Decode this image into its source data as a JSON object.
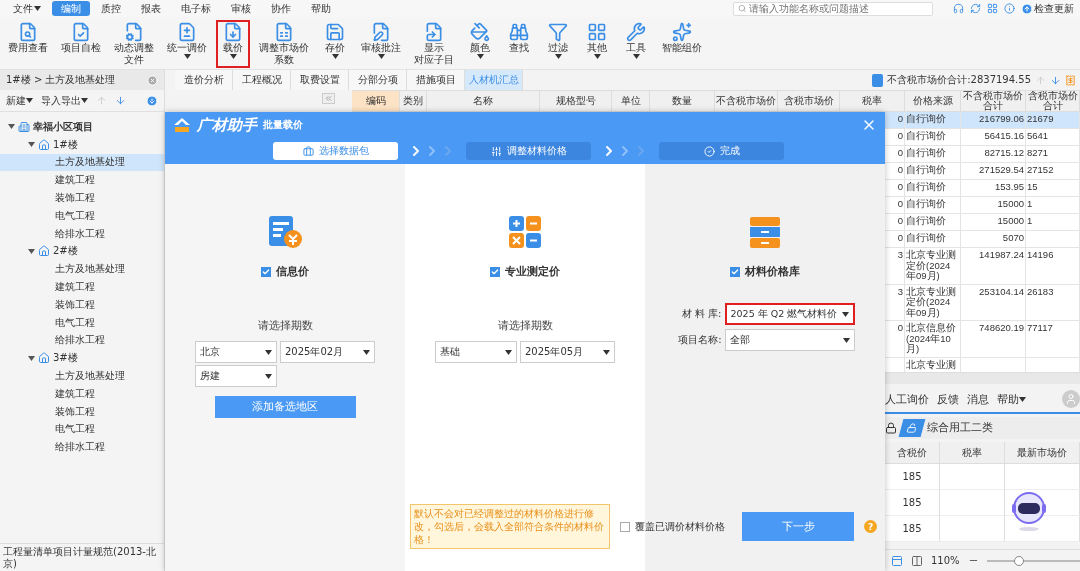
{
  "menu": {
    "items": [
      {
        "label": "文件",
        "dropdown": true,
        "selected": false
      },
      {
        "label": "编制",
        "dropdown": false,
        "selected": true
      },
      {
        "label": "质控",
        "dropdown": false,
        "selected": false
      },
      {
        "label": "报表",
        "dropdown": false,
        "selected": false
      },
      {
        "label": "电子标",
        "dropdown": false,
        "selected": false
      },
      {
        "label": "审核",
        "dropdown": false,
        "selected": false
      },
      {
        "label": "协作",
        "dropdown": false,
        "selected": false
      },
      {
        "label": "帮助",
        "dropdown": false,
        "selected": false
      }
    ],
    "search": {
      "placeholder": "请输入功能名称或问题描述"
    },
    "update": "检查更新"
  },
  "ribbon": [
    {
      "label": "费用查看",
      "dropdown": false,
      "highlighted": false
    },
    {
      "label": "项目自检",
      "dropdown": false,
      "highlighted": false
    },
    {
      "lines": [
        "动态调整",
        "文件"
      ],
      "dropdown": false,
      "highlighted": false
    },
    {
      "label": "统一调价",
      "dropdown": true,
      "highlighted": false
    },
    {
      "label": "载价",
      "dropdown": true,
      "highlighted": true
    },
    {
      "lines": [
        "调整市场价",
        "系数"
      ],
      "dropdown": false,
      "highlighted": false
    },
    {
      "label": "存价",
      "dropdown": true,
      "highlighted": false
    },
    {
      "label": "审核批注",
      "dropdown": true,
      "highlighted": false
    },
    {
      "lines": [
        "显示",
        "对应子目"
      ],
      "dropdown": false,
      "highlighted": false
    },
    {
      "label": "颜色",
      "dropdown": true,
      "highlighted": false
    },
    {
      "label": "查找",
      "dropdown": false,
      "highlighted": false
    },
    {
      "label": "过滤",
      "dropdown": true,
      "highlighted": false
    },
    {
      "label": "其他",
      "dropdown": true,
      "highlighted": false
    },
    {
      "label": "工具",
      "dropdown": true,
      "highlighted": false
    },
    {
      "label": "智能组价",
      "dropdown": false,
      "highlighted": false
    }
  ],
  "sidebar": {
    "breadcrumb": "1#楼 > 土方及地基处理",
    "toolbar": [
      {
        "label": "新建",
        "dropdown": true
      },
      {
        "label": "导入导出",
        "dropdown": true
      }
    ],
    "arrows": [
      {
        "kind": "up",
        "disabled": true
      },
      {
        "kind": "down",
        "disabled": false
      }
    ],
    "tree": [
      {
        "label": "幸福小区项目",
        "expanded": true,
        "selected": false,
        "children": [
          {
            "label": "1#楼",
            "expanded": true,
            "selected": false,
            "children": [
              {
                "label": "土方及地基处理",
                "selected": true
              },
              {
                "label": "建筑工程",
                "selected": false
              },
              {
                "label": "装饰工程",
                "selected": false
              },
              {
                "label": "电气工程",
                "selected": false
              },
              {
                "label": "给排水工程",
                "selected": false
              }
            ]
          },
          {
            "label": "2#楼",
            "expanded": true,
            "selected": false,
            "children": [
              {
                "label": "土方及地基处理",
                "selected": false
              },
              {
                "label": "建筑工程",
                "selected": false
              },
              {
                "label": "装饰工程",
                "selected": false
              },
              {
                "label": "电气工程",
                "selected": false
              },
              {
                "label": "给排水工程",
                "selected": false
              }
            ]
          },
          {
            "label": "3#楼",
            "expanded": true,
            "selected": false,
            "children": [
              {
                "label": "土方及地基处理",
                "selected": false
              },
              {
                "label": "建筑工程",
                "selected": false
              },
              {
                "label": "装饰工程",
                "selected": false
              },
              {
                "label": "电气工程",
                "selected": false
              },
              {
                "label": "给排水工程",
                "selected": false
              }
            ]
          }
        ]
      }
    ],
    "status": "工程量清单项目计量规范(2013-北京)"
  },
  "tabs": [
    {
      "label": "造价分析",
      "selected": false
    },
    {
      "label": "工程概况",
      "selected": false
    },
    {
      "label": "取费设置",
      "selected": false
    },
    {
      "label": "分部分项",
      "selected": false
    },
    {
      "label": "措施项目",
      "selected": false
    },
    {
      "label": "人材机汇总",
      "selected": true
    }
  ],
  "total": "不含税市场价合计:2837194.55",
  "table": {
    "columns": [
      {
        "label": "编码",
        "selected": true
      },
      {
        "label": "类别",
        "selected": false
      },
      {
        "label": "名称",
        "selected": false
      },
      {
        "label": "规格型号",
        "selected": false
      },
      {
        "label": "单位",
        "selected": false
      },
      {
        "label": "数量",
        "selected": false
      },
      {
        "label": "不含税市场价",
        "selected": false
      },
      {
        "label": "含税市场价",
        "selected": false
      },
      {
        "label": "税率",
        "selected": false
      },
      {
        "label": "价格来源",
        "selected": false
      },
      {
        "label": "不含税市场价合计",
        "selected": false
      },
      {
        "label": "含税市场价合计",
        "selected": false
      }
    ],
    "rows": [
      {
        "tax_rate": "0",
        "price_source": "自行询价",
        "total_excl_tax": "216799.06",
        "total_incl_tax": "21679",
        "selected": true
      },
      {
        "tax_rate": "0",
        "price_source": "自行询价",
        "total_excl_tax": "56415.16",
        "total_incl_tax": "5641",
        "selected": false
      },
      {
        "tax_rate": "0",
        "price_source": "自行询价",
        "total_excl_tax": "82715.12",
        "total_incl_tax": "8271",
        "selected": false
      },
      {
        "tax_rate": "0",
        "price_source": "自行询价",
        "total_excl_tax": "271529.54",
        "total_incl_tax": "27152",
        "selected": false
      },
      {
        "tax_rate": "0",
        "price_source": "自行询价",
        "total_excl_tax": "153.95",
        "total_incl_tax": "15",
        "selected": false
      },
      {
        "tax_rate": "0",
        "price_source": "自行询价",
        "total_excl_tax": "15000",
        "total_incl_tax": "1",
        "selected": false
      },
      {
        "tax_rate": "0",
        "price_source": "自行询价",
        "total_excl_tax": "15000",
        "total_incl_tax": "1",
        "selected": false
      },
      {
        "tax_rate": "0",
        "price_source": "自行询价",
        "total_excl_tax": "5070",
        "selected": false
      },
      {
        "tax_rate": "3",
        "price_source": "北京专业测定价(2024年09月)",
        "total_excl_tax": "141987.24",
        "total_incl_tax": "14196",
        "selected": false
      },
      {
        "tax_rate": "3",
        "price_source": "北京专业测定价(2024年09月)",
        "total_excl_tax": "253104.14",
        "total_incl_tax": "26183",
        "selected": false
      },
      {
        "tax_rate": "0",
        "price_source": "北京信息价(2024年10月)",
        "total_excl_tax": "748620.19",
        "total_incl_tax": "77117",
        "selected": false
      },
      {
        "price_source": "北京专业测",
        "selected": false
      }
    ]
  },
  "lower_panel": {
    "toolbar": [
      {
        "label": "人工询价",
        "dropdown": false
      },
      {
        "label": "反馈",
        "dropdown": false
      },
      {
        "label": "消息",
        "dropdown": false
      },
      {
        "label": "帮助",
        "dropdown": true
      }
    ],
    "tab": "综合用工二类",
    "columns": [
      "含税价",
      "税率",
      "最新市场价"
    ],
    "rows": [
      {
        "incl_tax_price": "185"
      },
      {
        "incl_tax_price": "185"
      },
      {
        "incl_tax_price": "185"
      }
    ],
    "zoom": {
      "reading": "110%",
      "level": 0.35
    }
  },
  "dialog": {
    "brand": "广材助手",
    "title": "批量载价",
    "steps": [
      {
        "label": "选择数据包",
        "selected": true
      },
      {
        "label": "调整材料价格",
        "selected": false
      },
      {
        "label": "完成",
        "selected": false
      }
    ],
    "sources": [
      {
        "kind": "info",
        "label": "信息价",
        "checked": true,
        "prompt": "请选择期数",
        "selects": [
          "北京",
          "2025年02月",
          "房建"
        ],
        "button": "添加备选地区"
      },
      {
        "kind": "measured",
        "label": "专业测定价",
        "checked": true,
        "prompt": "请选择期数",
        "selects": [
          "基础",
          "2025年05月"
        ]
      },
      {
        "kind": "library",
        "label": "材料价格库",
        "checked": true,
        "fields": [
          {
            "label": "材 料 库:",
            "value": "2025 年 Q2 燃气材料价",
            "highlighted": true
          },
          {
            "label": "项目名称:",
            "value": "全部",
            "highlighted": false
          }
        ]
      }
    ],
    "hint": "默认不会对已经调整过的材料价格进行修改，勾选后，会载入全部符合条件的材料价格！",
    "overwrite": {
      "label": "覆盖已调价材料价格",
      "checked": false
    },
    "next_button": "下一步",
    "help": "?"
  }
}
